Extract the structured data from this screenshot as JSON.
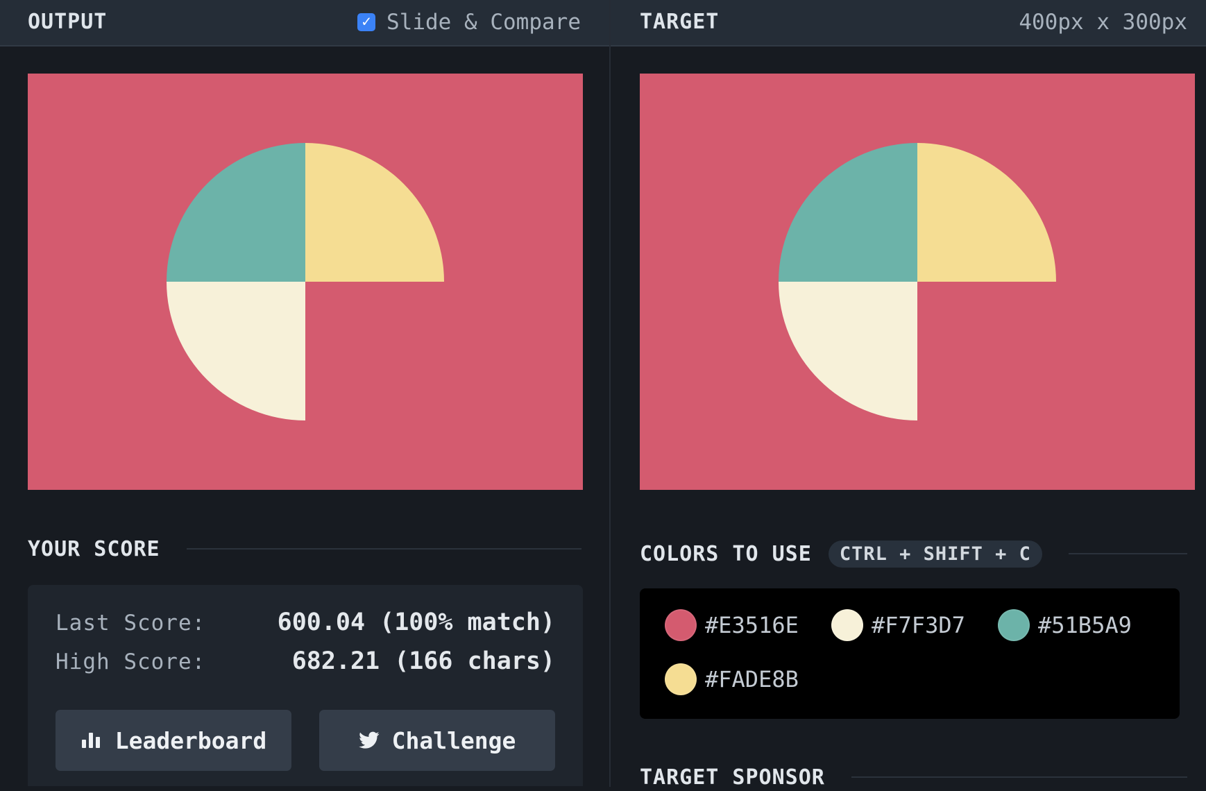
{
  "output_panel": {
    "title": "OUTPUT",
    "compare_label": "Slide & Compare",
    "compare_checked": true
  },
  "target_panel": {
    "title": "TARGET",
    "dimensions": "400px x 300px"
  },
  "canvas": {
    "background": "#d45b6f",
    "quadrants": {
      "top_left": "#6cb3a9",
      "top_right": "#f5dd93",
      "bottom_left": "#f7f1d9"
    }
  },
  "score": {
    "heading": "YOUR SCORE",
    "last_label": "Last Score:",
    "last_value": "600.04 (100% match)",
    "high_label": "High Score:",
    "high_value": "682.21 (166 chars)",
    "leaderboard_label": "Leaderboard",
    "challenge_label": "Challenge"
  },
  "colors": {
    "heading": "COLORS TO USE",
    "shortcut": "CTRL + SHIFT + C",
    "swatches": [
      {
        "hex": "#E3516E",
        "display": "#d45b6f"
      },
      {
        "hex": "#F7F3D7",
        "display": "#f7f1d9"
      },
      {
        "hex": "#51B5A9",
        "display": "#6cb3a9"
      },
      {
        "hex": "#FADE8B",
        "display": "#f5dd93"
      }
    ]
  },
  "sponsor": {
    "heading": "TARGET SPONSOR"
  }
}
